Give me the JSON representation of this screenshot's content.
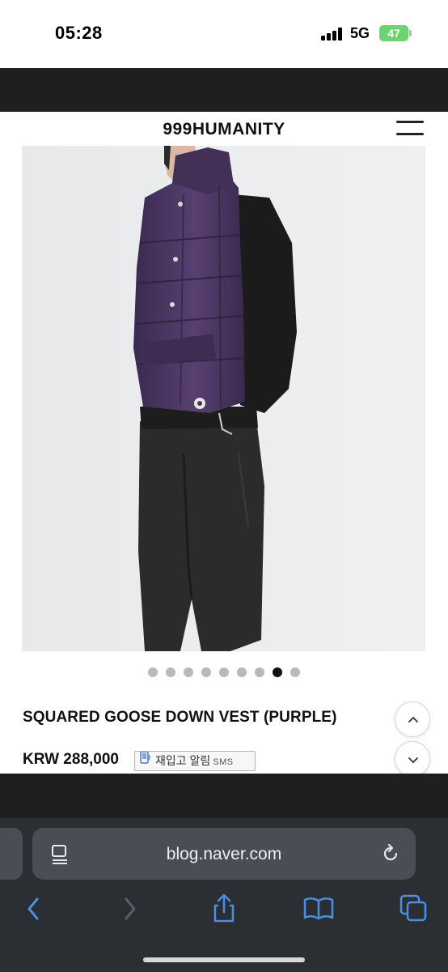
{
  "status_bar": {
    "time": "05:28",
    "network": "5G",
    "battery": "47"
  },
  "site": {
    "logo": "999HUMANITY",
    "menu_icon": "hamburger-icon"
  },
  "carousel": {
    "total": 9,
    "active_index": 7
  },
  "product": {
    "title": "SQUARED GOOSE DOWN VEST (PURPLE)",
    "price": "KRW 288,000",
    "restock_label": "재입고 알림",
    "restock_sms": "SMS"
  },
  "browser": {
    "url": "blog.naver.com"
  },
  "colors": {
    "vest_purple": "#4b3560",
    "background_gray": "#e9ebec",
    "chrome_dark": "#2b2e33",
    "toolbar_blue": "#4a90e2",
    "battery_green": "#6cd36e"
  }
}
